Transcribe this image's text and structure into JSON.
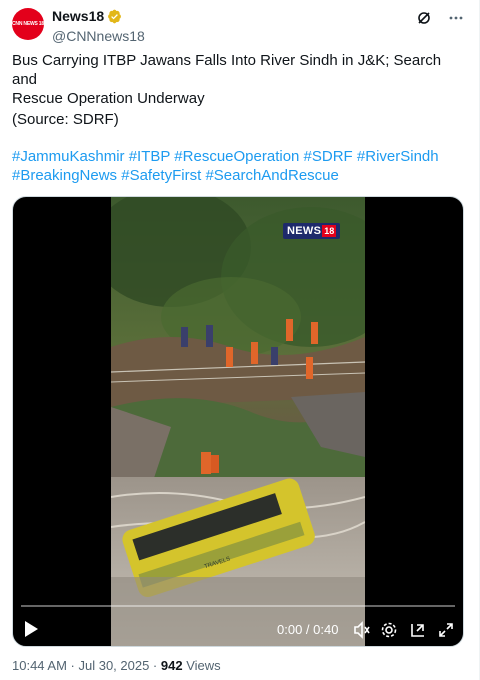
{
  "account": {
    "display_name": "News18",
    "handle": "@CNNnews18",
    "avatar_text": "CNN NEWS 18",
    "verified_color": "#e2b719"
  },
  "post": {
    "text_line1": "Bus Carrying ITBP Jawans Falls Into River Sindh in J&K; Search and",
    "text_line2": "Rescue Operation Underway",
    "source": "(Source: SDRF)",
    "hashtags": [
      "#JammuKashmir",
      "#ITBP",
      "#RescueOperation",
      "#SDRF",
      "#RiverSindh",
      "#BreakingNews",
      "#SafetyFirst",
      "#SearchAndRescue"
    ],
    "hashtag_color": "#1d9bf0"
  },
  "video": {
    "watermark_brand": "NEWS",
    "watermark_number": "18",
    "current_time": "0:00",
    "separator": " / ",
    "duration": "0:40",
    "progress": 0.0
  },
  "footer": {
    "timestamp": "10:44 AM · Jul 30, 2025 · ",
    "views_count": "942",
    "views_label": " Views"
  }
}
